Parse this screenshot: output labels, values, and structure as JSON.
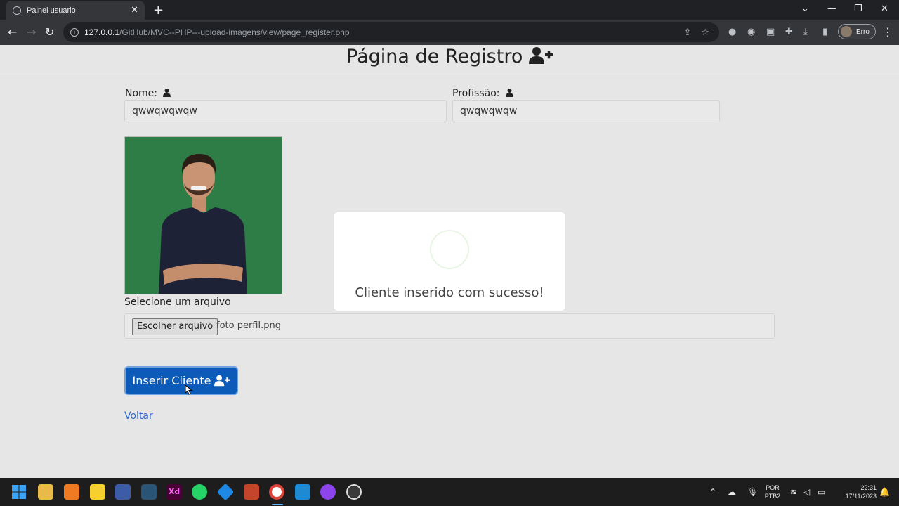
{
  "browser": {
    "tab_title": "Painel usuario",
    "url_host": "127.0.0.1",
    "url_path": "/GitHub/MVC--PHP---upload-imagens/view/page_register.php",
    "profile_label": "Erro"
  },
  "page": {
    "title": "Página de Registro",
    "name_label": "Nome:",
    "name_value": "qwwqwqwqw",
    "profession_label": "Profissão:",
    "profession_value": "qwqwqwqw",
    "file_label": "Selecione um arquivo",
    "file_button": "Escolher arquivo",
    "file_name": "foto perfil.png",
    "submit_label": "Inserir Cliente",
    "back_link": "Voltar"
  },
  "modal": {
    "message": "Cliente inserido com sucesso!"
  },
  "taskbar": {
    "lang_line1": "POR",
    "lang_line2": "PTB2",
    "time": "22:31",
    "date": "17/11/2023"
  },
  "colors": {
    "primary_button": "#0d5bb8",
    "photo_background": "#2e7d46",
    "link": "#2e6bd1"
  }
}
